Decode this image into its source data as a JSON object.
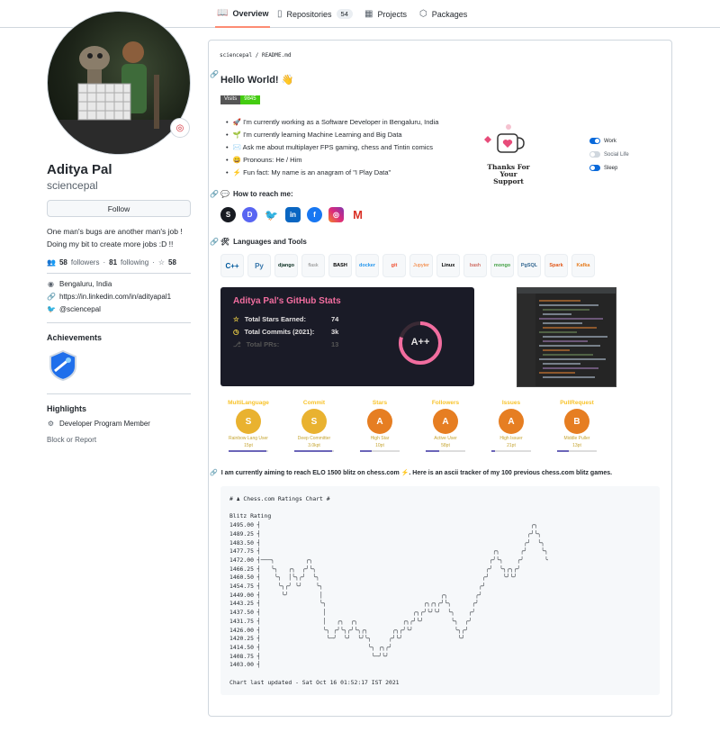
{
  "tabs": [
    {
      "label": "Overview",
      "icon": "book-icon"
    },
    {
      "label": "Repositories",
      "icon": "repo-icon",
      "count": "54"
    },
    {
      "label": "Projects",
      "icon": "project-icon"
    },
    {
      "label": "Packages",
      "icon": "package-icon"
    }
  ],
  "profile": {
    "name": "Aditya Pal",
    "login": "sciencepal",
    "follow_label": "Follow",
    "bio_line1": "One man's bugs are another man's job !",
    "bio_line2": "Doing my bit to create more jobs :D !!",
    "followers_count": "58",
    "followers_label": "followers",
    "following_count": "81",
    "following_label": "following",
    "stars_count": "58",
    "location": "Bengaluru, India",
    "website": "https://in.linkedin.com/in/adityapal1",
    "twitter": "@sciencepal",
    "emoji_status": "◎"
  },
  "sidebar": {
    "achievements_title": "Achievements",
    "highlights_title": "Highlights",
    "highlight_item": "Developer Program Member",
    "block_report": "Block or Report"
  },
  "readme": {
    "path_user": "sciencepal",
    "path_file": "README.md",
    "greeting": "Hello World! 👋",
    "visits_label": "Visits",
    "visits_count": "9845",
    "bullets": [
      "🚀 I'm currently working as a Software Developer in Bengaluru, India",
      "🌱 I'm currently learning Machine Learning and Big Data",
      "✉️ Ask me about multiplayer FPS gaming, chess and Tintin comics",
      "😄 Pronouns: He / Him",
      "⚡ Fun fact: My name is an anagram of \"I Play Data\""
    ],
    "thanks_text": "Thanks For Your Support",
    "legend": [
      "Work",
      "Social Life",
      "Sleep"
    ],
    "reach_title": "How to reach me:",
    "languages_title": "Languages and Tools",
    "tools": [
      "C++",
      "Py",
      "django",
      "flask",
      "BASH",
      "docker",
      "git",
      "Jupyter",
      "Linux",
      "bash",
      "mongo",
      "PgSQL",
      "Spark",
      "Kafka"
    ],
    "stats_title": "Aditya Pal's GitHub Stats",
    "stats": [
      {
        "label": "Total Stars Earned:",
        "value": "74"
      },
      {
        "label": "Total Commits (2021):",
        "value": "3k"
      },
      {
        "label": "Total PRs:",
        "value": "13"
      }
    ],
    "grade": "A++",
    "trophies": [
      {
        "title": "MultiLanguage",
        "rank": "S",
        "sub1": "Rainbow Lang User",
        "sub2": "15pt",
        "progress": 0.95,
        "color": "#e9b230"
      },
      {
        "title": "Commit",
        "rank": "S",
        "sub1": "Deep Committer",
        "sub2": "3.0kpt",
        "progress": 0.95,
        "color": "#e9b230"
      },
      {
        "title": "Stars",
        "rank": "A",
        "sub1": "High Star",
        "sub2": "10pt",
        "progress": 0.3,
        "color": "#e67e22"
      },
      {
        "title": "Followers",
        "rank": "A",
        "sub1": "Active User",
        "sub2": "58pt",
        "progress": 0.35,
        "color": "#e67e22"
      },
      {
        "title": "Issues",
        "rank": "A",
        "sub1": "High Issuer",
        "sub2": "21pt",
        "progress": 0.1,
        "color": "#e67e22"
      },
      {
        "title": "PullRequest",
        "rank": "B",
        "sub1": "Middle Puller",
        "sub2": "13pt",
        "progress": 0.3,
        "color": "#e67e22"
      }
    ],
    "chess_intro": "I am currently aiming to reach ELO 1500 blitz on chess.com ⚡. Here is an ascii tracker of my 100 previous chess.com blitz games.",
    "chess_chart_title": "# ♟ Chess.com Ratings Chart #",
    "chess_chart_ylabel": "Blitz Rating",
    "chess_updated": "Chart last updated - Sat Oct 16 01:52:17 IST 2021"
  },
  "chart_data": {
    "type": "line",
    "title": "# ♟ Chess.com Ratings Chart #",
    "ylabel": "Blitz Rating",
    "ylim": [
      1403.0,
      1495.0
    ],
    "y_ticks": [
      "1495.00",
      "1489.25",
      "1483.50",
      "1477.75",
      "1472.00",
      "1466.25",
      "1460.50",
      "1454.75",
      "1449.00",
      "1443.25",
      "1437.50",
      "1431.75",
      "1426.00",
      "1420.25",
      "1414.50",
      "1408.75",
      "1403.00"
    ],
    "series": [
      {
        "values": [
          1472.0,
          1472.0,
          1472.0,
          1466.25,
          1460.5,
          1454.75,
          1449.0,
          1454.75,
          1466.25,
          1460.5,
          1454.75,
          1460.5,
          1466.25,
          1472.0,
          1466.25,
          1460.5,
          1454.75,
          1443.25,
          1426.0,
          1420.25,
          1420.25,
          1426.0,
          1431.75,
          1426.0,
          1420.25,
          1426.0,
          1431.75,
          1426.0,
          1420.25,
          1426.0,
          1420.25,
          1414.5,
          1408.75,
          1408.75,
          1414.5,
          1408.75,
          1414.5,
          1420.25,
          1426.0,
          1420.25,
          1426.0,
          1431.75,
          1426.0,
          1431.75,
          1437.5,
          1431.75,
          1437.5,
          1443.25,
          1437.5,
          1443.25,
          1437.5,
          1443.25,
          1449.0,
          1443.25,
          1437.5,
          1431.75,
          1426.0,
          1420.25,
          1426.0,
          1431.75,
          1437.5,
          1443.25,
          1449.0,
          1454.75,
          1460.5,
          1466.25,
          1472.0,
          1477.75,
          1472.0,
          1466.25,
          1460.5,
          1466.25,
          1460.5,
          1466.25,
          1472.0,
          1477.75,
          1483.5,
          1489.25,
          1495.0,
          1489.25,
          1483.5,
          1477.75,
          1472.0
        ]
      }
    ]
  }
}
